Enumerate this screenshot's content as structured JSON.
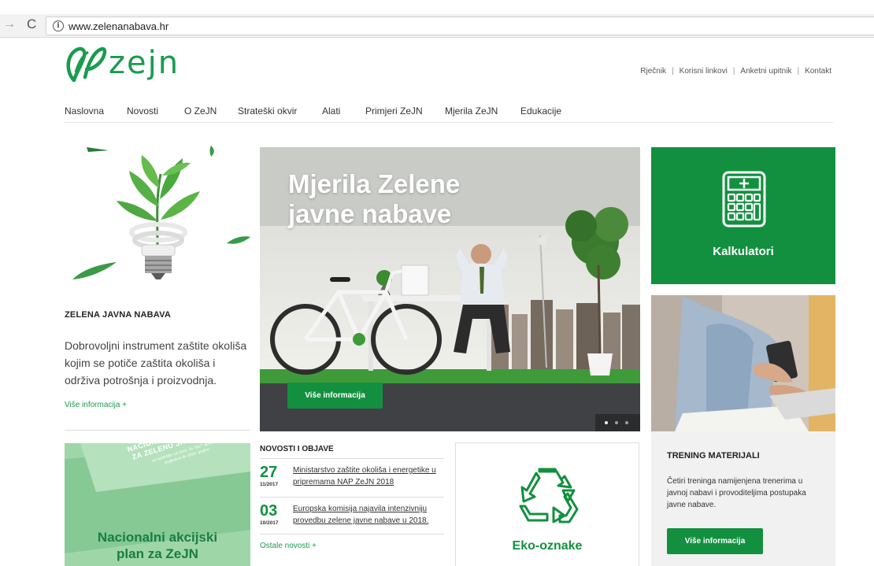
{
  "browser": {
    "url": "www.zelenanabava.hr"
  },
  "header": {
    "logo_text": "ZeJN",
    "top_links": [
      "Rječnik",
      "Korisni linkovi",
      "Anketni upitnik",
      "Kontakt"
    ],
    "nav": [
      "Naslovna",
      "Novosti",
      "O ZeJN",
      "Strateški okvir",
      "Alati",
      "Primjeri ZeJN",
      "Mjerila ZeJN",
      "Edukacije"
    ]
  },
  "left": {
    "title": "ZELENA JAVNA NABAVA",
    "description": "Dobrovoljni instrument zaštite okoliša kojim se potiče zaštita okoliša i održiva potrošnja i proizvodnja.",
    "more_link": "Više informacija +",
    "nap_panel": {
      "title_line1": "Nacionalni akcijski",
      "title_line2": "plan za ZeJN",
      "brochure_line1": "NACIONALNI AKCIJSKI PLAN",
      "brochure_line2": "ZA ZELENU JAVNU NABAVU",
      "brochure_line3": "za razdoblje od 2016. do 2017. godine s",
      "brochure_line4": "pogledom do 2020. godine"
    }
  },
  "hero": {
    "title_line1": "Mjerila Zelene",
    "title_line2": "javne nabave",
    "button": "Više informacija",
    "slide_count": 3,
    "active_slide": 1
  },
  "calculators": {
    "label": "Kalkulatori",
    "icon": "calculator-icon"
  },
  "training": {
    "title": "TRENING MATERIJALI",
    "description": "Četiri treninga namijenjena trenerima u javnoj nabavi i provoditeljima postupaka javne nabave.",
    "button": "Više informacija"
  },
  "news": {
    "title": "NOVOSTI I OBJAVE",
    "items": [
      {
        "day": "27",
        "month": "11/2017",
        "text": "Ministarstvo zaštite okoliša i energetike u pripremama NAP ZeJN 2018"
      },
      {
        "day": "03",
        "month": "10/2017",
        "text": "Europska komisija najavila intenzivniju provedbu zelene javne nabave u 2018."
      }
    ],
    "more_link": "Ostale novosti +"
  },
  "eko": {
    "label": "Eko-oznake",
    "icon": "recycle-icon"
  },
  "colors": {
    "brand_green": "#13903f",
    "logo_green": "#1a9b4f",
    "hero_bg": "#3f4145"
  }
}
